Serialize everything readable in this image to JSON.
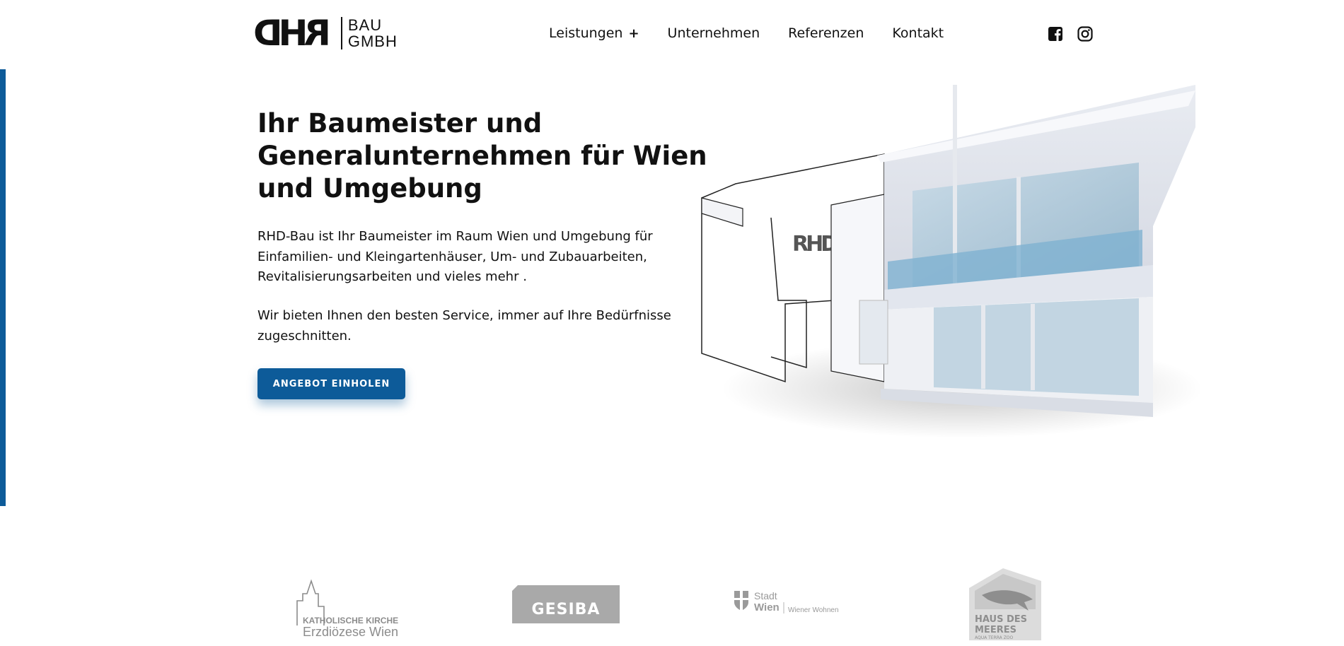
{
  "header": {
    "logo": {
      "mark": "RHD",
      "line1": "BAU",
      "line2": "GMBH"
    },
    "nav": [
      {
        "label": "Leistungen",
        "has_submenu": true,
        "submenu_icon": "+"
      },
      {
        "label": "Unternehmen"
      },
      {
        "label": "Referenzen"
      },
      {
        "label": "Kontakt"
      }
    ],
    "social": [
      {
        "icon": "facebook-icon"
      },
      {
        "icon": "instagram-icon"
      }
    ]
  },
  "hero": {
    "title": "Ihr Baumeister und Generalunternehmen für Wien und Umgebung",
    "paragraph1": "RHD-Bau ist Ihr Baumeister im Raum Wien und Umgebung für Einfamilien- und Kleingartenhäuser, Um- und Zubauarbeiten, Revitalisierungsarbeiten und vieles mehr .",
    "paragraph2": "Wir bieten Ihnen den besten Service, immer auf Ihre Bedürfnisse zugeschnitten.",
    "cta_label": "ANGEBOT EINHOLEN",
    "house_logo": "RHD"
  },
  "partners": [
    {
      "name": "katholische-kirche",
      "line1": "KATHOLISCHE KIRCHE",
      "line2": "Erzdiözese Wien"
    },
    {
      "name": "gesiba",
      "line1": "GESIBA"
    },
    {
      "name": "stadt-wien",
      "line1": "Stadt",
      "line2": "Wien",
      "line3": "Wiener Wohnen"
    },
    {
      "name": "haus-des-meeres",
      "line1": "HAUS DES",
      "line2": "MEERES",
      "line3": "AQUA TERRA ZOO"
    }
  ],
  "colors": {
    "accent": "#0d5b99",
    "text": "#111111",
    "partner_gray": "#9a9a9a"
  }
}
